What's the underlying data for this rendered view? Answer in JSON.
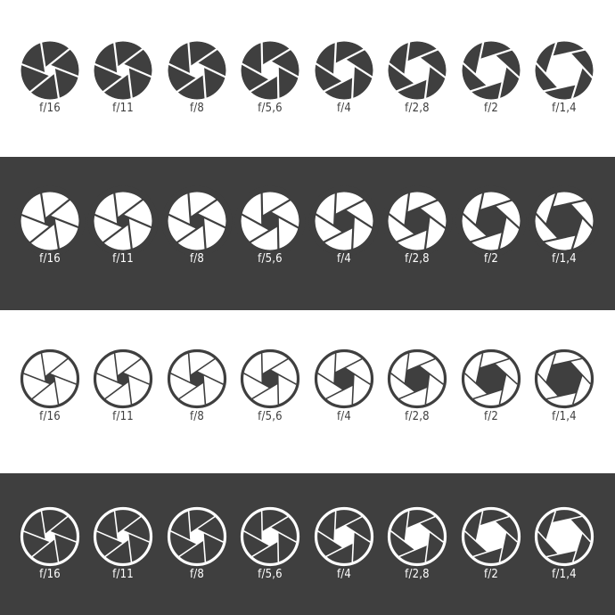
{
  "colors": {
    "dark": "#3f3f3f",
    "light": "#ffffff"
  },
  "icon": "camera-aperture-icon",
  "rows": [
    {
      "style": "solid-dark-on-light",
      "items": [
        {
          "label": "f/16",
          "aperture": 0.1
        },
        {
          "label": "f/11",
          "aperture": 0.16
        },
        {
          "label": "f/8",
          "aperture": 0.24
        },
        {
          "label": "f/5,6",
          "aperture": 0.34
        },
        {
          "label": "f/4",
          "aperture": 0.46
        },
        {
          "label": "f/2,8",
          "aperture": 0.6
        },
        {
          "label": "f/2",
          "aperture": 0.75
        },
        {
          "label": "f/1,4",
          "aperture": 0.92
        }
      ]
    },
    {
      "style": "solid-light-on-dark",
      "items": [
        {
          "label": "f/16",
          "aperture": 0.1
        },
        {
          "label": "f/11",
          "aperture": 0.16
        },
        {
          "label": "f/8",
          "aperture": 0.24
        },
        {
          "label": "f/5,6",
          "aperture": 0.34
        },
        {
          "label": "f/4",
          "aperture": 0.46
        },
        {
          "label": "f/2,8",
          "aperture": 0.6
        },
        {
          "label": "f/2",
          "aperture": 0.75
        },
        {
          "label": "f/1,4",
          "aperture": 0.92
        }
      ]
    },
    {
      "style": "outline-dark-on-light",
      "items": [
        {
          "label": "f/16",
          "aperture": 0.1
        },
        {
          "label": "f/11",
          "aperture": 0.16
        },
        {
          "label": "f/8",
          "aperture": 0.24
        },
        {
          "label": "f/5,6",
          "aperture": 0.34
        },
        {
          "label": "f/4",
          "aperture": 0.46
        },
        {
          "label": "f/2,8",
          "aperture": 0.6
        },
        {
          "label": "f/2",
          "aperture": 0.75
        },
        {
          "label": "f/1,4",
          "aperture": 0.92
        }
      ]
    },
    {
      "style": "outline-light-on-dark",
      "items": [
        {
          "label": "f/16",
          "aperture": 0.1
        },
        {
          "label": "f/11",
          "aperture": 0.16
        },
        {
          "label": "f/8",
          "aperture": 0.24
        },
        {
          "label": "f/5,6",
          "aperture": 0.34
        },
        {
          "label": "f/4",
          "aperture": 0.46
        },
        {
          "label": "f/2,8",
          "aperture": 0.6
        },
        {
          "label": "f/2",
          "aperture": 0.75
        },
        {
          "label": "f/1,4",
          "aperture": 0.92
        }
      ]
    }
  ]
}
